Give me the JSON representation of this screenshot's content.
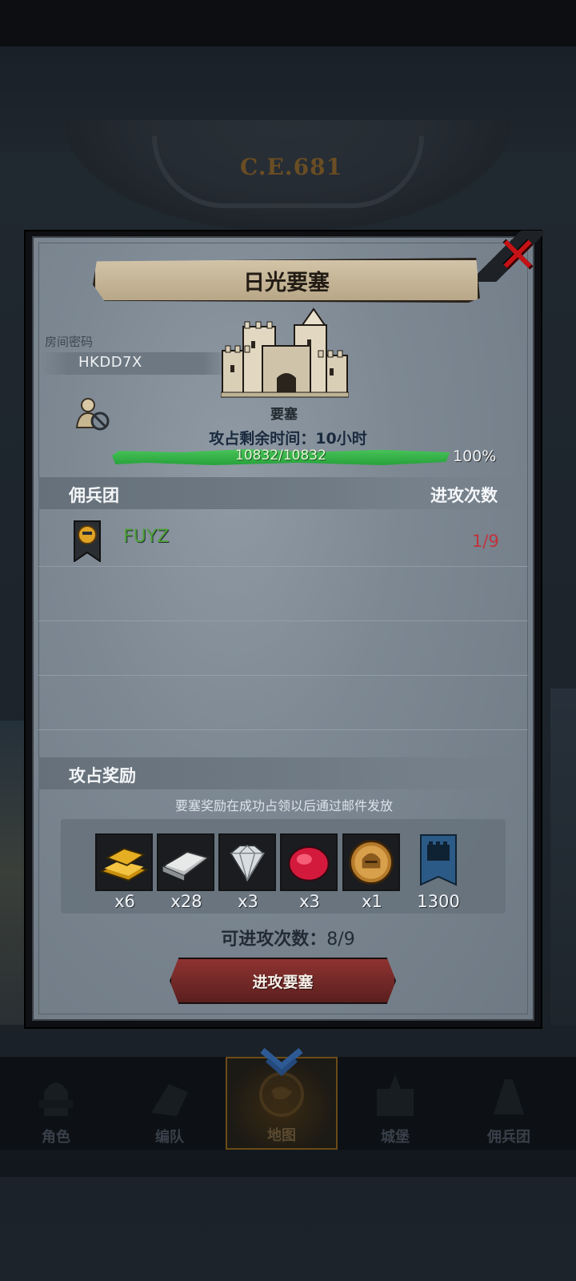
{
  "background": {
    "era_label": "C.E.681"
  },
  "modal": {
    "title": "日光要塞",
    "close_icon": "close-x-icon",
    "room_password_label": "房间密码",
    "room_password": "HKDD7X",
    "fortress_label": "要塞",
    "occupy_time_label": "攻占剩余时间：",
    "occupy_time_value": "10小时",
    "hp_text": "10832/10832",
    "hp_percent_text": "100%",
    "hp_fraction": 1.0,
    "mercenary_header": "佣兵团",
    "attack_count_header": "进攻次数",
    "mercenaries": [
      {
        "name": "FUYZ",
        "count": "1/9",
        "icon": "mercenary-banner-icon"
      }
    ],
    "reward_header": "攻占奖励",
    "reward_note": "要塞奖励在成功占领以后通过邮件发放",
    "rewards": [
      {
        "icon": "gold-bar-icon",
        "qty": "x6"
      },
      {
        "icon": "iron-bar-icon",
        "qty": "x28"
      },
      {
        "icon": "diamond-icon",
        "qty": "x3"
      },
      {
        "icon": "ruby-icon",
        "qty": "x3"
      },
      {
        "icon": "helmet-medal-icon",
        "qty": "x1"
      },
      {
        "icon": "fortress-banner-icon",
        "qty": "1300"
      }
    ],
    "remaining_attacks_label": "可进攻次数：",
    "remaining_attacks_value": "8/9",
    "attack_button": "进攻要塞"
  },
  "nav": {
    "items": [
      {
        "label": "角色",
        "icon": "knight-icon"
      },
      {
        "label": "编队",
        "icon": "formation-icon"
      },
      {
        "label": "地图",
        "icon": "map-globe-icon",
        "active": true
      },
      {
        "label": "城堡",
        "icon": "castle-icon"
      },
      {
        "label": "佣兵团",
        "icon": "mercenary-icon"
      }
    ]
  },
  "colors": {
    "accent_red": "#c51216",
    "hp_green": "#2fa83f",
    "attack_btn": "#7a2a28",
    "merc_name": "#4fa23a",
    "count_red": "#c2323a"
  }
}
